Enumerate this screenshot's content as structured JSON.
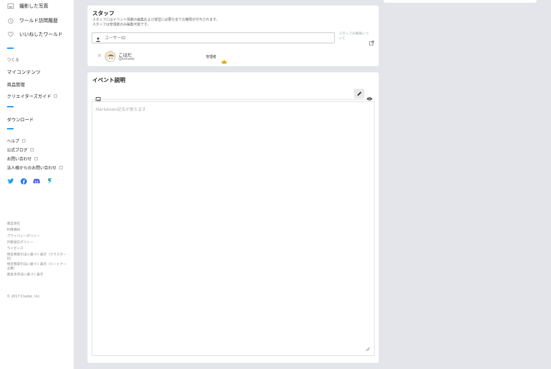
{
  "sidebar": {
    "top_items": [
      {
        "label": "撮影した写真",
        "icon": "photo-icon"
      },
      {
        "label": "ワールド訪問履歴",
        "icon": "history-icon"
      },
      {
        "label": "いいねしたワールド",
        "icon": "heart-icon"
      }
    ],
    "create_label": "つくる",
    "create_items": [
      "マイコンテンツ",
      "商品管理",
      "クリエイターズガイド"
    ],
    "download_label": "ダウンロード",
    "help_items": [
      "ヘルプ",
      "公式ブログ",
      "お問い合わせ",
      "法人様からのお問い合わせ"
    ],
    "social": [
      {
        "icon": "twitter-icon",
        "color": "#1da1f2"
      },
      {
        "icon": "facebook-icon",
        "color": "#1877f2"
      },
      {
        "icon": "discord-icon",
        "color": "#5865f2"
      },
      {
        "icon": "sketchfab-icon",
        "color": "#1caad9"
      }
    ],
    "footer_links": [
      "運営会社",
      "利用規約",
      "プライバシーポリシー",
      "外部送信ポリシー",
      "ライセンス",
      "特定商取引法に基づく表示（クラスター社）",
      "特定商取引法に基づく表示（リートナー企業）",
      "資金決済法に基づく表示"
    ],
    "copyright": "© 2017 Cluster, Inc."
  },
  "staff": {
    "title": "スタッフ",
    "desc_line1": "スタッフにはイベント情報の編集および運営に必要な全ての権限が付与されます。",
    "desc_line2": "スタッフは管理者のみ編集可能です。",
    "search_placeholder": "ユーザーID",
    "permissions_link_line1": "スタッフの権限につ",
    "permissions_link_line2": "いて",
    "member": {
      "display_name": "こはだ",
      "user_id": "@kohada",
      "role": "管理者"
    }
  },
  "event": {
    "title": "イベント説明",
    "editor_placeholder": "Markdown記法が使えます"
  },
  "colors": {
    "accent": "#2d9bf0",
    "crown": "#e0a800"
  }
}
